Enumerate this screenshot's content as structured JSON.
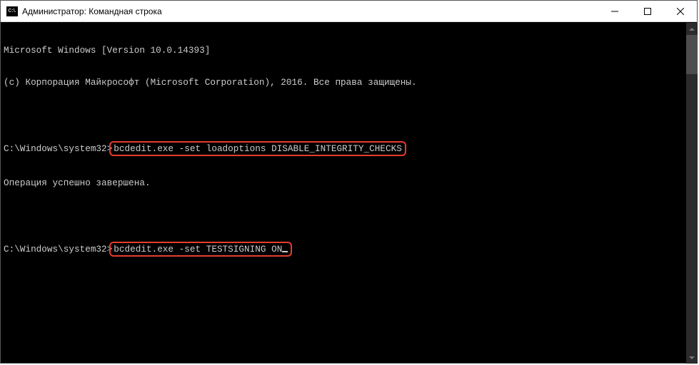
{
  "title": "Администратор: Командная строка",
  "app_icon_text": "C:\\.",
  "lines": {
    "l1": "Microsoft Windows [Version 10.0.14393]",
    "l2": "(c) Корпорация Майкрософт (Microsoft Corporation), 2016. Все права защищены.",
    "l3": "",
    "p1": "C:\\Windows\\system32>",
    "c1": "bcdedit.exe -set loadoptions DISABLE_INTEGRITY_CHECKS",
    "l4": "Операция успешно завершена.",
    "l5": "",
    "p2": "C:\\Windows\\system32>",
    "c2": "bcdedit.exe -set TESTSIGNING ON"
  }
}
